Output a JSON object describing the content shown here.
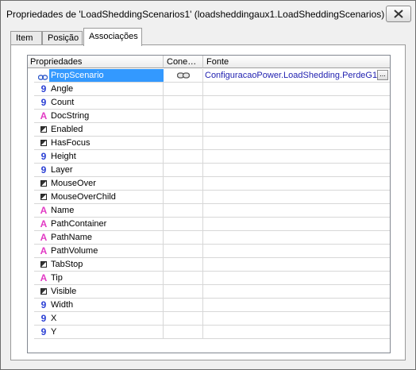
{
  "window": {
    "title": "Propriedades de 'LoadSheddingScenarios1' (loadsheddingaux1.LoadSheddingScenarios)"
  },
  "tabs": [
    {
      "label": "Item"
    },
    {
      "label": "Posição"
    },
    {
      "label": "Associações"
    }
  ],
  "grid": {
    "headers": {
      "propriedades": "Propriedades",
      "conexao": "Cone…",
      "fonte": "Fonte"
    },
    "rows": [
      {
        "name": "PropScenario",
        "type": "link",
        "fonte": "ConfiguracaoPower.LoadShedding.PerdeG1",
        "selected": true,
        "connected": true
      },
      {
        "name": "Angle",
        "type": "number"
      },
      {
        "name": "Count",
        "type": "number"
      },
      {
        "name": "DocString",
        "type": "string"
      },
      {
        "name": "Enabled",
        "type": "boolean"
      },
      {
        "name": "HasFocus",
        "type": "boolean"
      },
      {
        "name": "Height",
        "type": "number"
      },
      {
        "name": "Layer",
        "type": "number"
      },
      {
        "name": "MouseOver",
        "type": "boolean"
      },
      {
        "name": "MouseOverChild",
        "type": "boolean"
      },
      {
        "name": "Name",
        "type": "string"
      },
      {
        "name": "PathContainer",
        "type": "string"
      },
      {
        "name": "PathName",
        "type": "string"
      },
      {
        "name": "PathVolume",
        "type": "string"
      },
      {
        "name": "TabStop",
        "type": "boolean"
      },
      {
        "name": "Tip",
        "type": "string"
      },
      {
        "name": "Visible",
        "type": "boolean"
      },
      {
        "name": "Width",
        "type": "number"
      },
      {
        "name": "X",
        "type": "number"
      },
      {
        "name": "Y",
        "type": "number"
      }
    ],
    "ellipsis_label": "..."
  },
  "icons": {
    "number_glyph": "9",
    "string_glyph": "A"
  }
}
